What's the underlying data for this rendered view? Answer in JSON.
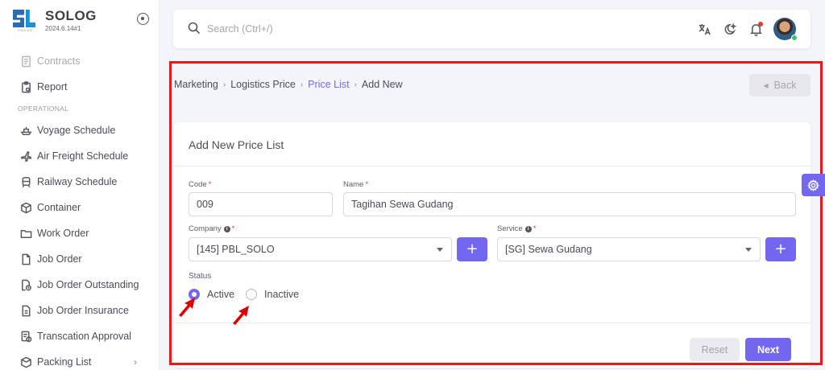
{
  "brand": {
    "name": "SOLOG",
    "version": "2024.6.14#1",
    "logo_tag": "SOLOG"
  },
  "sidebar": {
    "items_top": [
      {
        "label": "Contracts",
        "icon": "file-text-icon",
        "faded": true
      },
      {
        "label": "Report",
        "icon": "report-icon",
        "faded": false
      }
    ],
    "section_label": "OPERATIONAL",
    "items": [
      {
        "label": "Voyage Schedule",
        "icon": "ship-icon"
      },
      {
        "label": "Air Freight Schedule",
        "icon": "plane-icon"
      },
      {
        "label": "Railway Schedule",
        "icon": "train-icon"
      },
      {
        "label": "Container",
        "icon": "box-icon"
      },
      {
        "label": "Work Order",
        "icon": "folder-icon"
      },
      {
        "label": "Job Order",
        "icon": "file-icon"
      },
      {
        "label": "Job Order Outstanding",
        "icon": "file-clock-icon"
      },
      {
        "label": "Job Order Insurance",
        "icon": "file-doc-icon"
      },
      {
        "label": "Transcation Approval",
        "icon": "approval-icon"
      },
      {
        "label": "Packing List",
        "icon": "package-icon",
        "chevron": "›"
      }
    ]
  },
  "search": {
    "placeholder": "Search (Ctrl+/)"
  },
  "breadcrumb": {
    "items": [
      "Marketing",
      "Logistics Price",
      "Price List",
      "Add New"
    ],
    "separator": "›"
  },
  "back_button": {
    "label": "Back"
  },
  "form": {
    "title": "Add New Price List",
    "code": {
      "label": "Code",
      "value": "009"
    },
    "name": {
      "label": "Name",
      "value": "Tagihan Sewa Gudang"
    },
    "company": {
      "label": "Company",
      "value": "[145] PBL_SOLO"
    },
    "service": {
      "label": "Service",
      "value": "[SG] Sewa Gudang"
    },
    "plus_label": "+",
    "required_mark": "*",
    "info_mark": "i",
    "status": {
      "label": "Status",
      "options": [
        "Active",
        "Inactive"
      ],
      "selected": "Active"
    },
    "reset_label": "Reset",
    "next_label": "Next"
  },
  "colors": {
    "accent": "#7367f0",
    "highlight": "#e21b1b",
    "arrow": "#e00000"
  }
}
